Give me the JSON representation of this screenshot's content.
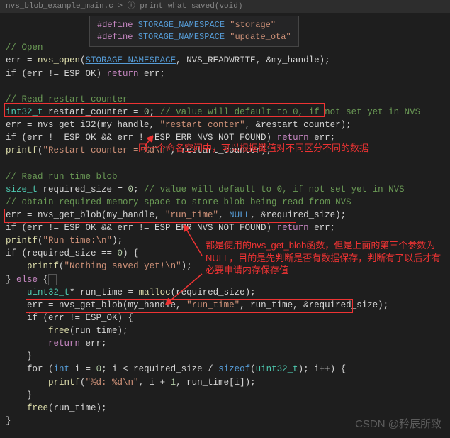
{
  "tab": {
    "name": "nvs_blob_example_main.c > ⓘ print what saved(void)"
  },
  "tooltip": {
    "l1_def": "#define",
    "l1_name": "STORAGE_NAMESPACE",
    "l1_val": "\"storage\"",
    "l2_def": "#define",
    "l2_name": "STORAGE_NAMESPACE",
    "l2_val": "\"update_ota\""
  },
  "code": {
    "c_open": "// Open",
    "l_open1a": "err = ",
    "l_open1_fn": "nvs_open",
    "l_open1b": "(",
    "l_open1_ns": "STORAGE_NAMESPACE",
    "l_open1c": ", NVS_READWRITE, &my_handle);",
    "l_open2a": "if (err != ESP_OK) ",
    "l_open2_kw": "return",
    "l_open2b": " err;",
    "c_rc": "// Read restart counter",
    "l_rc1_type": "int32_t",
    "l_rc1a": " restart_counter = ",
    "l_rc1_num": "0",
    "l_rc1b": "; ",
    "l_rc1_c": "// value will default to 0, if not set yet in NVS",
    "l_rc2a": "err = nvs_get_i32(my_handle, ",
    "l_rc2_str": "\"restart_conter\"",
    "l_rc2b": ", &restart_counter);",
    "l_rc3a": "if (err != ESP_OK && err != ESP_ERR_NVS_NOT_FOUND) ",
    "l_rc3_kw": "return",
    "l_rc3b": " err;",
    "l_rc4_fn": "printf",
    "l_rc4a": "(",
    "l_rc4_str": "\"Restart counter = %d\\n\"",
    "l_rc4b": ", restart_counter);",
    "c_rtb": "// Read run time blob",
    "l_rt1_type": "size_t",
    "l_rt1a": " required_size = ",
    "l_rt1_num": "0",
    "l_rt1b": "; ",
    "l_rt1_c": "// value will default to 0, if not set yet in NVS",
    "c_obt": "// obtain required memory space to store blob being read from NVS",
    "l_gb1a": "err = nvs_get_blob(my_handle, ",
    "l_gb1_str": "\"run_time\"",
    "l_gb1b": ", ",
    "l_gb1_null": "NULL",
    "l_gb1c": ", &required_size);",
    "l_gb2a": "if (err != ESP_OK && err != ESP_ERR_NVS_NOT_FOUND) ",
    "l_gb2_kw": "return",
    "l_gb2b": " err;",
    "l_gb3_fn": "printf",
    "l_gb3a": "(",
    "l_gb3_str": "\"Run time:\\n\"",
    "l_gb3b": ");",
    "l_if1a": "if (required_size == ",
    "l_if1_num": "0",
    "l_if1b": ") {",
    "l_p1_fn": "printf",
    "l_p1a": "(",
    "l_p1_str": "\"Nothing saved yet!\\n\"",
    "l_p1b": ");",
    "l_else": "} ",
    "l_else_kw": "else",
    "l_else_b": " {",
    "l_m1_type": "uint32_t",
    "l_m1a": "* run_time = ",
    "l_m1_fn": "malloc",
    "l_m1b": "(required_size);",
    "l_gb4a": "err = nvs_get_blob(my_handle, ",
    "l_gb4_str": "\"run_time\"",
    "l_gb4b": ", run_time, &required_size);",
    "l_if2a": "if (err != ESP_OK) {",
    "l_fr1_fn": "free",
    "l_fr1a": "(run_time);",
    "l_ret_kw": "return",
    "l_ret_a": " err;",
    "l_cb1": "}",
    "l_for1a": "for (",
    "l_for1_kw": "int",
    "l_for1b": " i = ",
    "l_for1_n1": "0",
    "l_for1c": "; i < required_size / ",
    "l_for1_soff": "sizeof",
    "l_for1d": "(",
    "l_for1_t": "uint32_t",
    "l_for1e": "); i++) {",
    "l_pf_fn": "printf",
    "l_pf_a": "(",
    "l_pf_str": "\"%d: %d\\n\"",
    "l_pf_b": ", i + ",
    "l_pf_n": "1",
    "l_pf_c": ", run_time[i]);",
    "l_cb2": "}",
    "l_fr2_fn": "free",
    "l_fr2a": "(run_time);",
    "l_cb3": "}"
  },
  "anno": {
    "a1": "同一个命名空间中，可以根据键值对不同区分不同的数据",
    "a2": "都是使用的nvs_get_blob函数，但是上面的第三个参数为NULL，目的是先判断是否有数据保存，判断有了以后才有必要申请内存保存值"
  },
  "watermark": "CSDN @矜辰所致"
}
